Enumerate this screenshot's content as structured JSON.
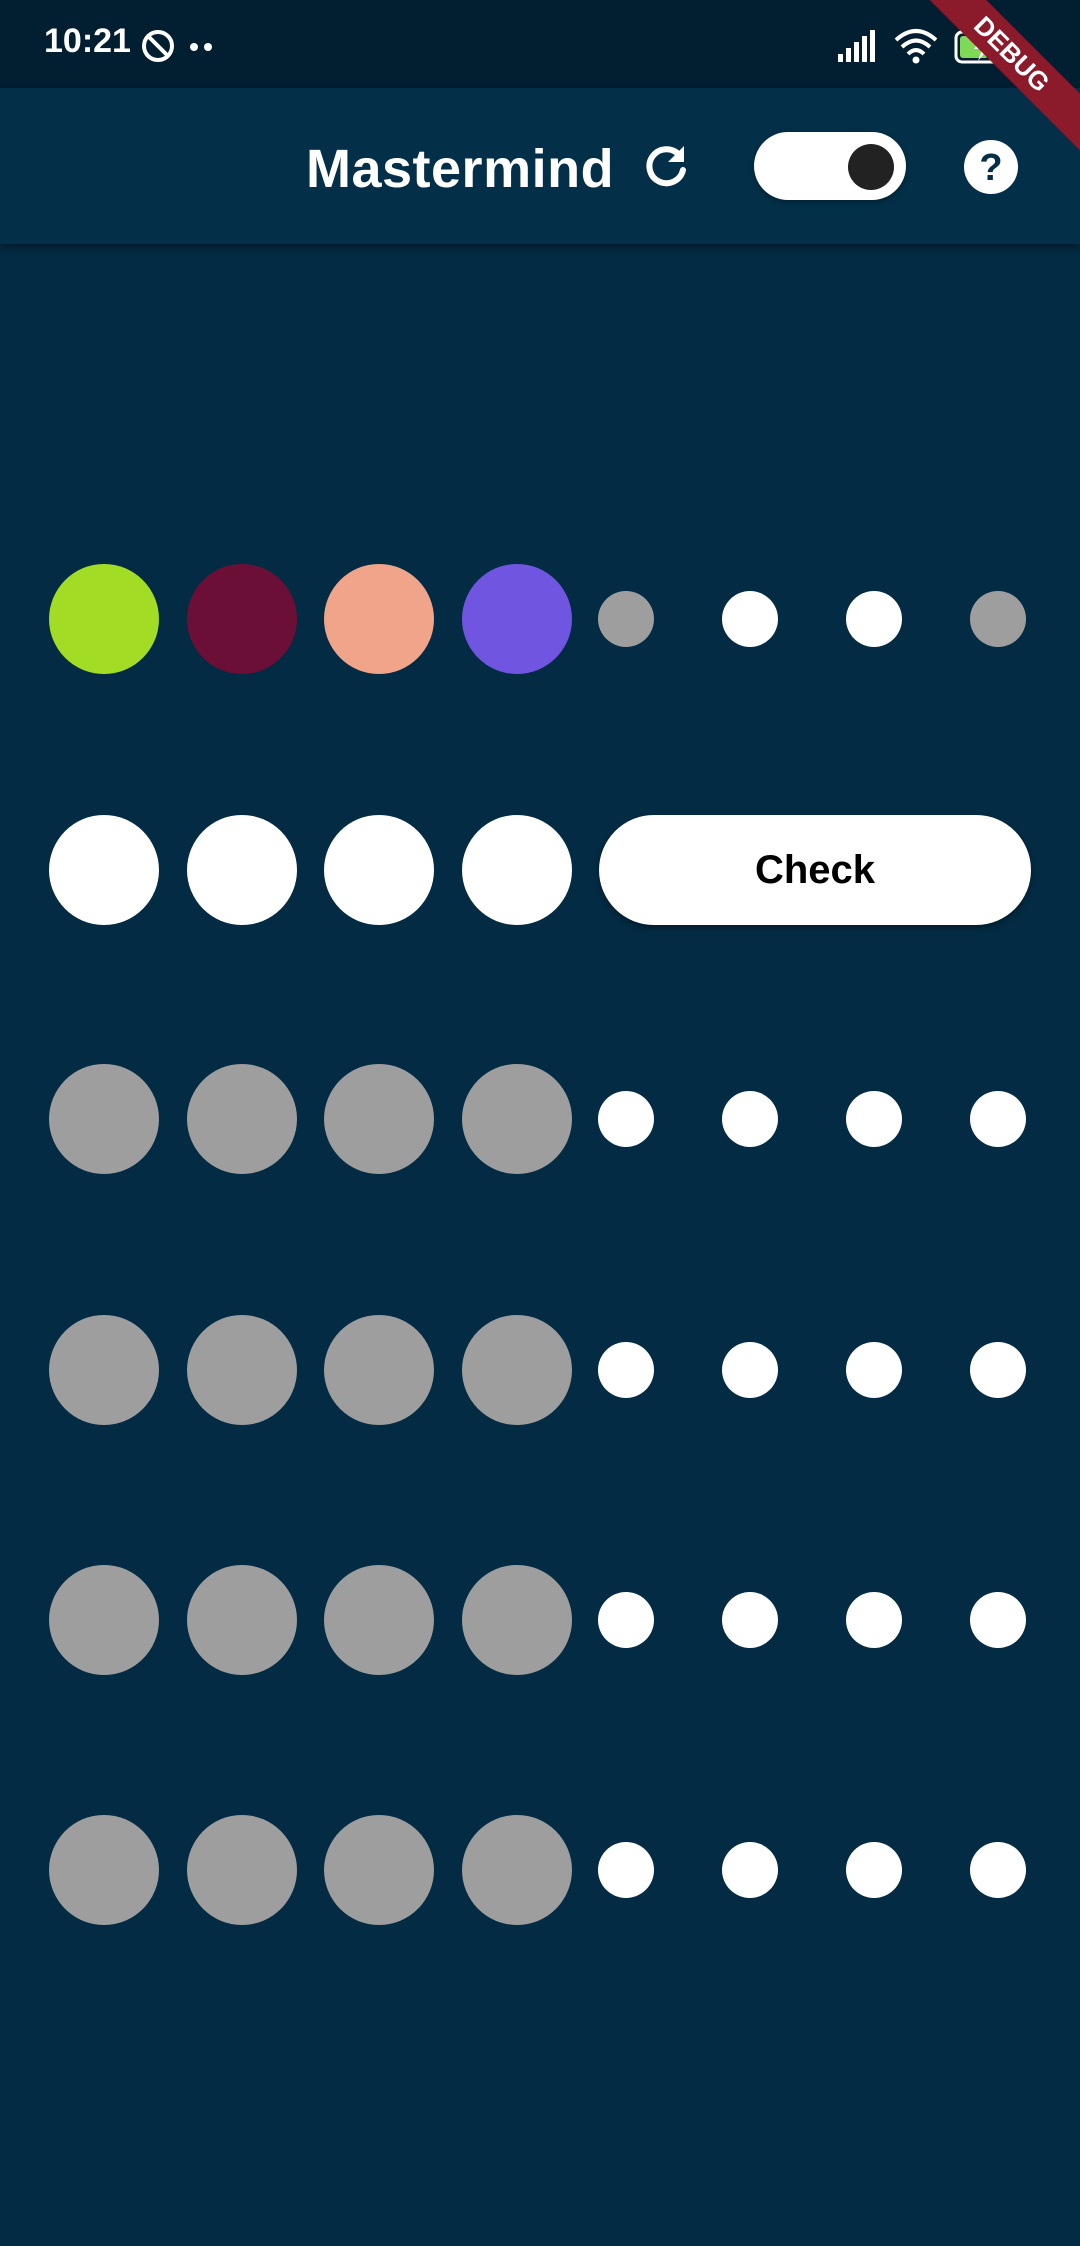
{
  "status_bar": {
    "time": "10:21",
    "icons": [
      "do-not-disturb-icon",
      "signal-icon",
      "wifi-icon",
      "battery-charging-icon"
    ]
  },
  "app_bar": {
    "title": "Mastermind",
    "refresh_icon": "refresh-icon",
    "toggle_state": "on",
    "help_icon": "help-icon"
  },
  "debug_banner": "DEBUG",
  "colors": {
    "background": "#032b43",
    "app_bar": "#033048",
    "empty_peg": "#9e9e9e",
    "active_slot": "#ffffff",
    "hint_white": "#ffffff",
    "hint_grey": "#9e9e9e"
  },
  "rows": [
    {
      "pegs": [
        "#a2dc24",
        "#6b0f37",
        "#f0a48a",
        "#6f55e0"
      ],
      "hints": [
        "grey",
        "white",
        "white",
        "grey"
      ]
    },
    {
      "pegs": [
        "#ffffff",
        "#ffffff",
        "#ffffff",
        "#ffffff"
      ],
      "check_label": "Check"
    },
    {
      "pegs": [
        "#9e9e9e",
        "#9e9e9e",
        "#9e9e9e",
        "#9e9e9e"
      ],
      "hints": [
        "white",
        "white",
        "white",
        "white"
      ]
    },
    {
      "pegs": [
        "#9e9e9e",
        "#9e9e9e",
        "#9e9e9e",
        "#9e9e9e"
      ],
      "hints": [
        "white",
        "white",
        "white",
        "white"
      ]
    },
    {
      "pegs": [
        "#9e9e9e",
        "#9e9e9e",
        "#9e9e9e",
        "#9e9e9e"
      ],
      "hints": [
        "white",
        "white",
        "white",
        "white"
      ]
    },
    {
      "pegs": [
        "#9e9e9e",
        "#9e9e9e",
        "#9e9e9e",
        "#9e9e9e"
      ],
      "hints": [
        "white",
        "white",
        "white",
        "white"
      ]
    }
  ]
}
